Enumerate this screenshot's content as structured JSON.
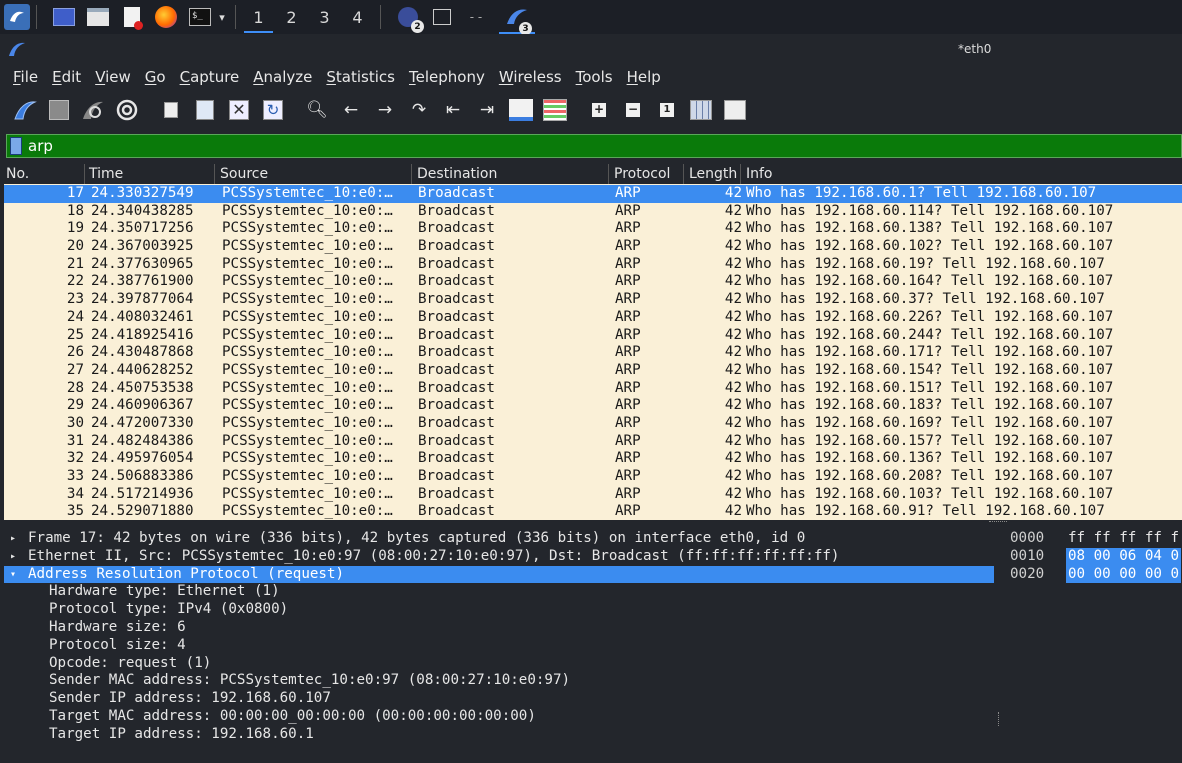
{
  "taskbar": {
    "workspaces": [
      "1",
      "2",
      "3",
      "4"
    ],
    "badges": {
      "a": "2",
      "b": "3"
    }
  },
  "window": {
    "title": "*eth0"
  },
  "menu": [
    "File",
    "Edit",
    "View",
    "Go",
    "Capture",
    "Analyze",
    "Statistics",
    "Telephony",
    "Wireless",
    "Tools",
    "Help"
  ],
  "filter": {
    "value": "arp",
    "color": "#0a7a0a"
  },
  "columns": [
    "No.",
    "Time",
    "Source",
    "Destination",
    "Protocol",
    "Length",
    "Info"
  ],
  "packets": [
    {
      "no": "17",
      "time": "24.330327549",
      "src": "PCSSystemtec_10:e0:…",
      "dst": "Broadcast",
      "proto": "ARP",
      "len": "42",
      "info": "Who has 192.168.60.1? Tell 192.168.60.107"
    },
    {
      "no": "18",
      "time": "24.340438285",
      "src": "PCSSystemtec_10:e0:…",
      "dst": "Broadcast",
      "proto": "ARP",
      "len": "42",
      "info": "Who has 192.168.60.114? Tell 192.168.60.107"
    },
    {
      "no": "19",
      "time": "24.350717256",
      "src": "PCSSystemtec_10:e0:…",
      "dst": "Broadcast",
      "proto": "ARP",
      "len": "42",
      "info": "Who has 192.168.60.138? Tell 192.168.60.107"
    },
    {
      "no": "20",
      "time": "24.367003925",
      "src": "PCSSystemtec_10:e0:…",
      "dst": "Broadcast",
      "proto": "ARP",
      "len": "42",
      "info": "Who has 192.168.60.102? Tell 192.168.60.107"
    },
    {
      "no": "21",
      "time": "24.377630965",
      "src": "PCSSystemtec_10:e0:…",
      "dst": "Broadcast",
      "proto": "ARP",
      "len": "42",
      "info": "Who has 192.168.60.19? Tell 192.168.60.107"
    },
    {
      "no": "22",
      "time": "24.387761900",
      "src": "PCSSystemtec_10:e0:…",
      "dst": "Broadcast",
      "proto": "ARP",
      "len": "42",
      "info": "Who has 192.168.60.164? Tell 192.168.60.107"
    },
    {
      "no": "23",
      "time": "24.397877064",
      "src": "PCSSystemtec_10:e0:…",
      "dst": "Broadcast",
      "proto": "ARP",
      "len": "42",
      "info": "Who has 192.168.60.37? Tell 192.168.60.107"
    },
    {
      "no": "24",
      "time": "24.408032461",
      "src": "PCSSystemtec_10:e0:…",
      "dst": "Broadcast",
      "proto": "ARP",
      "len": "42",
      "info": "Who has 192.168.60.226? Tell 192.168.60.107"
    },
    {
      "no": "25",
      "time": "24.418925416",
      "src": "PCSSystemtec_10:e0:…",
      "dst": "Broadcast",
      "proto": "ARP",
      "len": "42",
      "info": "Who has 192.168.60.244? Tell 192.168.60.107"
    },
    {
      "no": "26",
      "time": "24.430487868",
      "src": "PCSSystemtec_10:e0:…",
      "dst": "Broadcast",
      "proto": "ARP",
      "len": "42",
      "info": "Who has 192.168.60.171? Tell 192.168.60.107"
    },
    {
      "no": "27",
      "time": "24.440628252",
      "src": "PCSSystemtec_10:e0:…",
      "dst": "Broadcast",
      "proto": "ARP",
      "len": "42",
      "info": "Who has 192.168.60.154? Tell 192.168.60.107"
    },
    {
      "no": "28",
      "time": "24.450753538",
      "src": "PCSSystemtec_10:e0:…",
      "dst": "Broadcast",
      "proto": "ARP",
      "len": "42",
      "info": "Who has 192.168.60.151? Tell 192.168.60.107"
    },
    {
      "no": "29",
      "time": "24.460906367",
      "src": "PCSSystemtec_10:e0:…",
      "dst": "Broadcast",
      "proto": "ARP",
      "len": "42",
      "info": "Who has 192.168.60.183? Tell 192.168.60.107"
    },
    {
      "no": "30",
      "time": "24.472007330",
      "src": "PCSSystemtec_10:e0:…",
      "dst": "Broadcast",
      "proto": "ARP",
      "len": "42",
      "info": "Who has 192.168.60.169? Tell 192.168.60.107"
    },
    {
      "no": "31",
      "time": "24.482484386",
      "src": "PCSSystemtec_10:e0:…",
      "dst": "Broadcast",
      "proto": "ARP",
      "len": "42",
      "info": "Who has 192.168.60.157? Tell 192.168.60.107"
    },
    {
      "no": "32",
      "time": "24.495976054",
      "src": "PCSSystemtec_10:e0:…",
      "dst": "Broadcast",
      "proto": "ARP",
      "len": "42",
      "info": "Who has 192.168.60.136? Tell 192.168.60.107"
    },
    {
      "no": "33",
      "time": "24.506883386",
      "src": "PCSSystemtec_10:e0:…",
      "dst": "Broadcast",
      "proto": "ARP",
      "len": "42",
      "info": "Who has 192.168.60.208? Tell 192.168.60.107"
    },
    {
      "no": "34",
      "time": "24.517214936",
      "src": "PCSSystemtec_10:e0:…",
      "dst": "Broadcast",
      "proto": "ARP",
      "len": "42",
      "info": "Who has 192.168.60.103? Tell 192.168.60.107"
    },
    {
      "no": "35",
      "time": "24.529071880",
      "src": "PCSSystemtec_10:e0:…",
      "dst": "Broadcast",
      "proto": "ARP",
      "len": "42",
      "info": "Who has 192.168.60.91? Tell 192.168.60.107"
    }
  ],
  "details": {
    "frame": "Frame 17: 42 bytes on wire (336 bits), 42 bytes captured (336 bits) on interface eth0, id 0",
    "ethernet": "Ethernet II, Src: PCSSystemtec_10:e0:97 (08:00:27:10:e0:97), Dst: Broadcast (ff:ff:ff:ff:ff:ff)",
    "arp": "Address Resolution Protocol (request)",
    "arp_fields": [
      "Hardware type: Ethernet (1)",
      "Protocol type: IPv4 (0x0800)",
      "Hardware size: 6",
      "Protocol size: 4",
      "Opcode: request (1)",
      "Sender MAC address: PCSSystemtec_10:e0:97 (08:00:27:10:e0:97)",
      "Sender IP address: 192.168.60.107",
      "Target MAC address: 00:00:00_00:00:00 (00:00:00:00:00:00)",
      "Target IP address: 192.168.60.1"
    ]
  },
  "bytes": [
    {
      "offset": "0000",
      "hex": "ff ff ff ff f"
    },
    {
      "offset": "0010",
      "hex": "08 00 06 04 0"
    },
    {
      "offset": "0020",
      "hex": "00 00 00 00 0"
    }
  ],
  "colors": {
    "selection": "#3b8cf0",
    "packet_row_bg": "#faf0d7",
    "filter_ok": "#0a7a0a"
  }
}
